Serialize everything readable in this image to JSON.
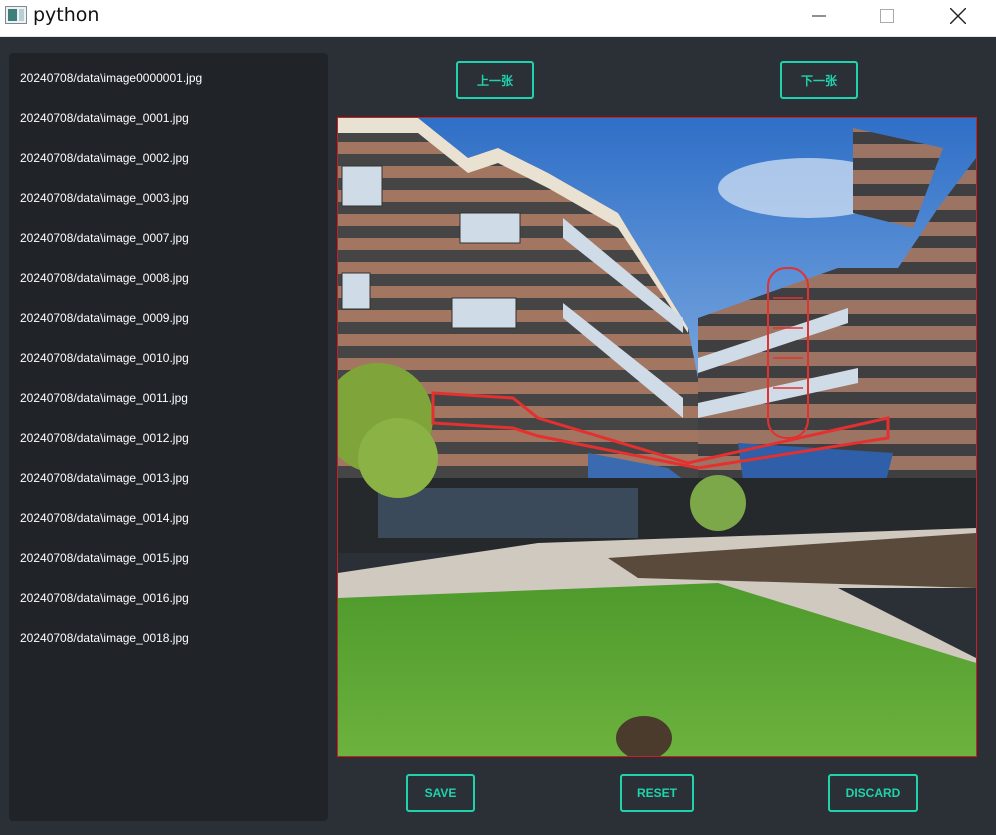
{
  "window": {
    "title": "python"
  },
  "file_list": {
    "items": [
      "20240708/data\\image0000001.jpg",
      "20240708/data\\image_0001.jpg",
      "20240708/data\\image_0002.jpg",
      "20240708/data\\image_0003.jpg",
      "20240708/data\\image_0007.jpg",
      "20240708/data\\image_0008.jpg",
      "20240708/data\\image_0009.jpg",
      "20240708/data\\image_0010.jpg",
      "20240708/data\\image_0011.jpg",
      "20240708/data\\image_0012.jpg",
      "20240708/data\\image_0013.jpg",
      "20240708/data\\image_0014.jpg",
      "20240708/data\\image_0015.jpg",
      "20240708/data\\image_0016.jpg",
      "20240708/data\\image_0018.jpg"
    ]
  },
  "nav": {
    "prev_label": "上一张",
    "next_label": "下一张"
  },
  "actions": {
    "save_label": "SAVE",
    "reset_label": "RESET",
    "discard_label": "DISCARD"
  },
  "colors": {
    "accent": "#1fd3ad",
    "frame_border": "#d01f1f",
    "annotation": "#e53030"
  }
}
